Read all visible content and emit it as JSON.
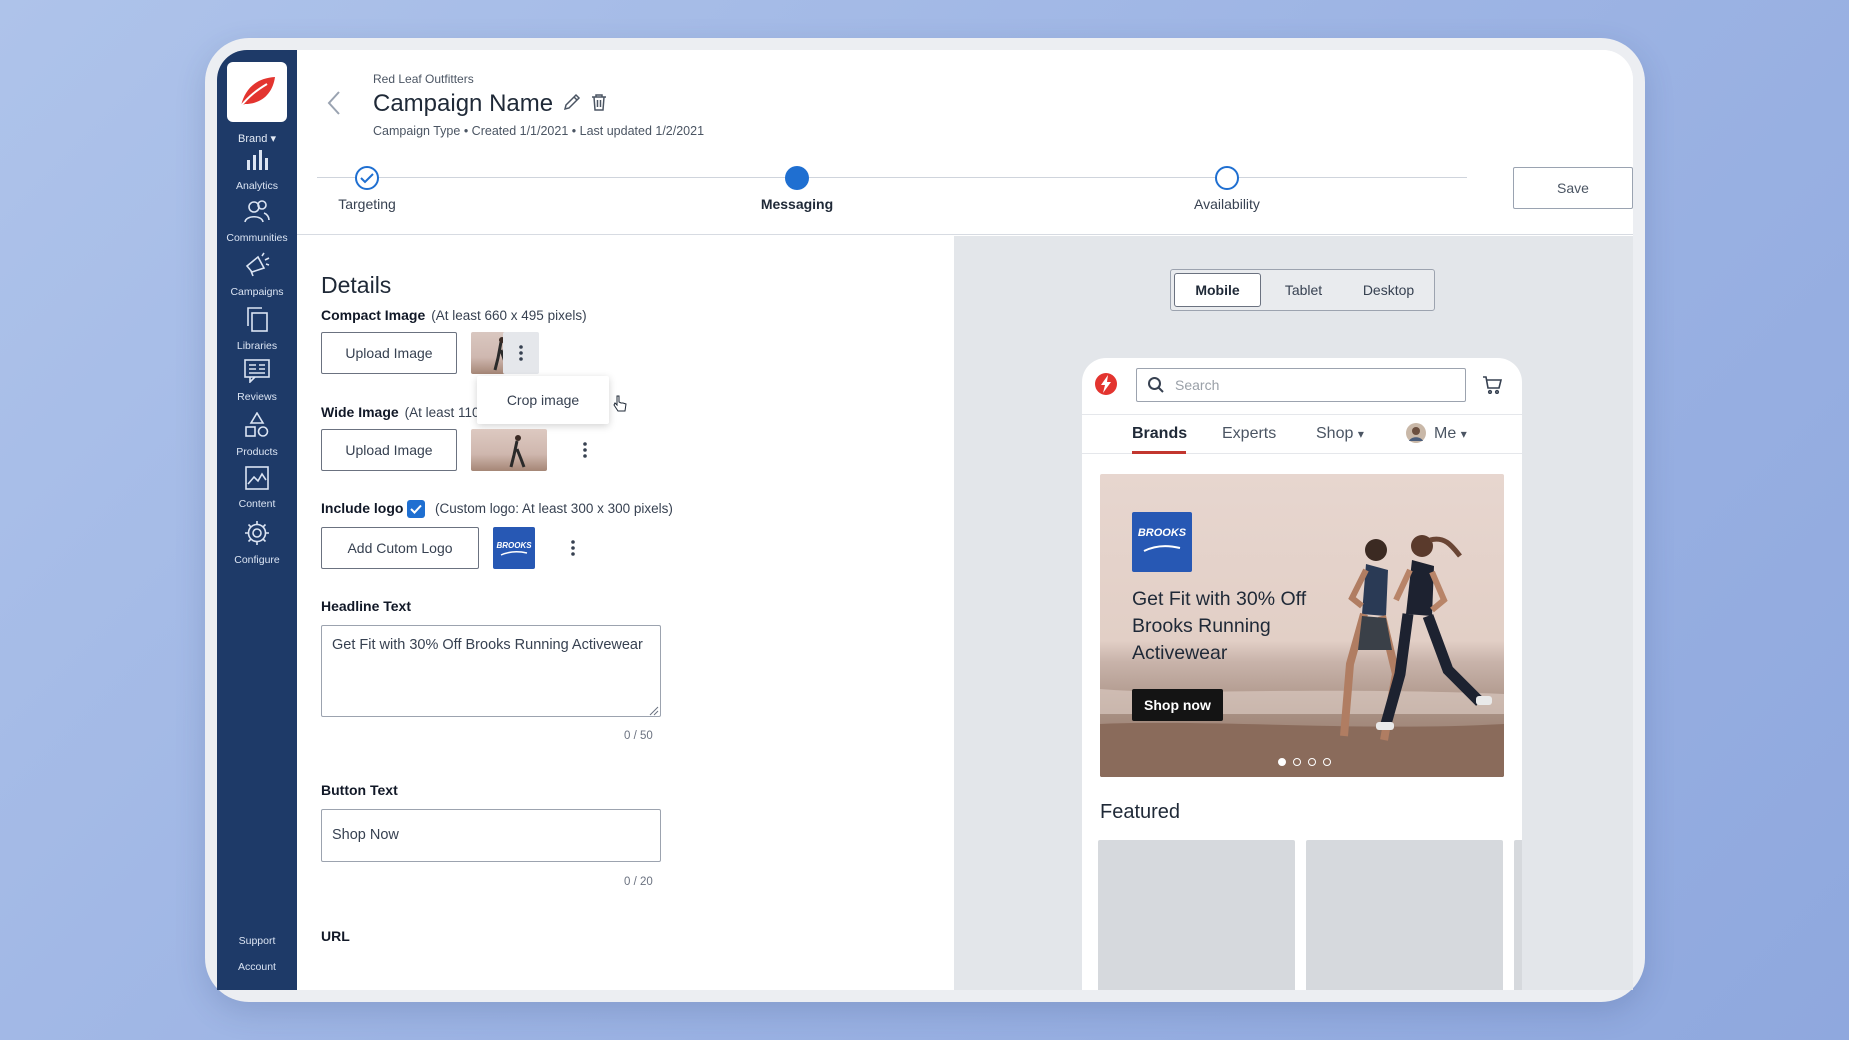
{
  "sidebar": {
    "brand_label": "Brand",
    "items": [
      {
        "label": "Analytics",
        "icon": "bar-chart-icon"
      },
      {
        "label": "Communities",
        "icon": "users-icon"
      },
      {
        "label": "Campaigns",
        "icon": "megaphone-icon"
      },
      {
        "label": "Libraries",
        "icon": "copy-icon"
      },
      {
        "label": "Reviews",
        "icon": "review-icon"
      },
      {
        "label": "Products",
        "icon": "shapes-icon"
      },
      {
        "label": "Content",
        "icon": "image-icon"
      },
      {
        "label": "Configure",
        "icon": "gear-icon"
      }
    ],
    "support_label": "Support",
    "account_label": "Account"
  },
  "header": {
    "org": "Red Leaf Outfitters",
    "title": "Campaign Name",
    "campaign_type": "Campaign Type",
    "created": "Created 1/1/2021",
    "updated": "Last updated 1/2/2021",
    "save_label": "Save",
    "steps": [
      {
        "label": "Targeting",
        "state": "complete"
      },
      {
        "label": "Messaging",
        "state": "current"
      },
      {
        "label": "Availability",
        "state": "upcoming"
      }
    ]
  },
  "form": {
    "heading": "Details",
    "compact_image": {
      "label": "Compact Image",
      "note": "(At least 660 x  495 pixels)",
      "button": "Upload Image"
    },
    "menu_item": "Crop image",
    "wide_image": {
      "label": "Wide Image",
      "note": "(At least 1104 x 62",
      "button": "Upload Image"
    },
    "logo": {
      "label": "Include logo",
      "checked": true,
      "note": "(Custom logo: At least 300 x 300 pixels)",
      "button": "Add Cutom Logo",
      "thumb_text": "BROOKS"
    },
    "headline": {
      "label": "Headline Text",
      "value": "Get Fit with 30% Off Brooks Running Activewear",
      "counter": "0 / 50"
    },
    "button_text": {
      "label": "Button Text",
      "value": "Shop Now",
      "counter": "0 / 20"
    },
    "url": {
      "label": "URL"
    }
  },
  "preview": {
    "devices": [
      "Mobile",
      "Tablet",
      "Desktop"
    ],
    "active_device": "Mobile",
    "search_placeholder": "Search",
    "tabs": [
      "Brands",
      "Experts",
      "Shop",
      "Me"
    ],
    "active_tab": "Brands",
    "hero": {
      "logo_text": "BROOKS",
      "headline": "Get Fit with 30% Off Brooks Running Activewear",
      "button": "Shop now",
      "slide_count": 4,
      "active_slide": 1
    },
    "featured_label": "Featured"
  },
  "colors": {
    "sidebar": "#1e3a68",
    "accent": "#1f6fd1",
    "brand_red": "#e3342f",
    "tab_underline": "#c2362f"
  }
}
